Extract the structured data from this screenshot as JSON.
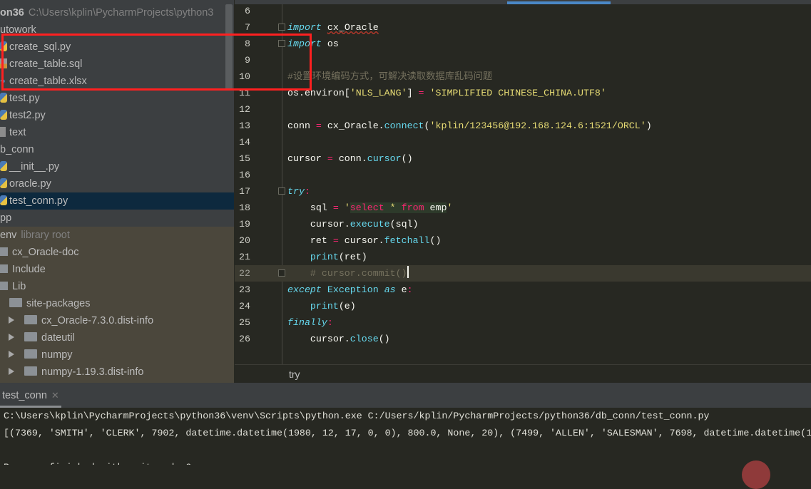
{
  "project_tree": {
    "root": {
      "name": "on36",
      "path": "C:\\Users\\kplin\\PycharmProjects\\python3"
    },
    "items": [
      {
        "label": "utowork",
        "icon": "folder-icon"
      },
      {
        "label": "create_sql.py",
        "icon": "python-file-icon"
      },
      {
        "label": "create_table.sql",
        "icon": "sql-file-icon"
      },
      {
        "label": "create_table.xlsx",
        "icon": "unknown-file-icon"
      },
      {
        "label": "test.py",
        "icon": "python-file-icon"
      },
      {
        "label": "test2.py",
        "icon": "python-file-icon"
      },
      {
        "label": "text",
        "icon": "text-file-icon"
      },
      {
        "label": "b_conn",
        "icon": "folder-icon"
      },
      {
        "label": "__init__.py",
        "icon": "python-file-icon"
      },
      {
        "label": "oracle.py",
        "icon": "python-file-icon"
      },
      {
        "label": "test_conn.py",
        "icon": "python-file-icon",
        "selected": true
      },
      {
        "label": "pp",
        "icon": "folder-icon"
      }
    ],
    "venv": {
      "label": "env",
      "hint": "library root"
    },
    "venv_items": [
      {
        "label": "cx_Oracle-doc",
        "icon": "folder-icon"
      },
      {
        "label": "Include",
        "icon": "folder-icon"
      },
      {
        "label": "Lib",
        "icon": "folder-icon"
      },
      {
        "label": "site-packages",
        "icon": "folder-icon"
      },
      {
        "label": "cx_Oracle-7.3.0.dist-info",
        "icon": "folder-icon",
        "collapsed": true
      },
      {
        "label": "dateutil",
        "icon": "folder-icon",
        "collapsed": true
      },
      {
        "label": "numpy",
        "icon": "folder-icon",
        "collapsed": true
      },
      {
        "label": "numpy-1.19.3.dist-info",
        "icon": "folder-icon",
        "collapsed": true
      }
    ]
  },
  "editor": {
    "current_line": 22,
    "lines": [
      {
        "n": "6",
        "t": []
      },
      {
        "n": "7",
        "fold": true,
        "t": [
          [
            "import",
            "kw"
          ],
          [
            " ",
            "pl"
          ],
          [
            "cx_Oracle",
            "pl wavy"
          ]
        ]
      },
      {
        "n": "8",
        "fold": true,
        "t": [
          [
            "import",
            "kw"
          ],
          [
            " os",
            "pl"
          ]
        ]
      },
      {
        "n": "9",
        "t": []
      },
      {
        "n": "10",
        "t": [
          [
            "#设置环境编码方式，可解决读取数据库乱码问题",
            "cm"
          ]
        ]
      },
      {
        "n": "11",
        "t": [
          [
            "os.environ[",
            "pl"
          ],
          [
            "'NLS_LANG'",
            "st"
          ],
          [
            "] ",
            "pl"
          ],
          [
            "=",
            "op"
          ],
          [
            " ",
            "pl"
          ],
          [
            "'SIMPLIFIED CHINESE_CHINA.UTF8'",
            "st"
          ]
        ]
      },
      {
        "n": "12",
        "t": []
      },
      {
        "n": "13",
        "t": [
          [
            "conn ",
            "pl"
          ],
          [
            "=",
            "op"
          ],
          [
            " cx_Oracle.",
            "pl"
          ],
          [
            "connect",
            "fn"
          ],
          [
            "(",
            "pl"
          ],
          [
            "'kplin/123456@192.168.124.6:1521/ORCL'",
            "st"
          ],
          [
            ")",
            "pl"
          ]
        ]
      },
      {
        "n": "14",
        "t": []
      },
      {
        "n": "15",
        "t": [
          [
            "cursor ",
            "pl"
          ],
          [
            "=",
            "op"
          ],
          [
            " conn.",
            "pl"
          ],
          [
            "cursor",
            "fn"
          ],
          [
            "()",
            "pl"
          ]
        ]
      },
      {
        "n": "16",
        "t": []
      },
      {
        "n": "17",
        "fold": true,
        "t": [
          [
            "try",
            "kw"
          ],
          [
            ":",
            "op"
          ]
        ]
      },
      {
        "n": "18",
        "t": [
          [
            "    sql ",
            "pl"
          ],
          [
            "=",
            "op"
          ],
          [
            " ",
            "pl"
          ],
          [
            "'",
            "st"
          ],
          [
            "select",
            "sq"
          ],
          [
            " ",
            "sqp"
          ],
          [
            "*",
            "sqs"
          ],
          [
            " ",
            "sqp"
          ],
          [
            "from",
            "sq"
          ],
          [
            " emp",
            "sqp"
          ],
          [
            "'",
            "st"
          ]
        ]
      },
      {
        "n": "19",
        "t": [
          [
            "    cursor.",
            "pl"
          ],
          [
            "execute",
            "fn"
          ],
          [
            "(sql)",
            "pl"
          ]
        ]
      },
      {
        "n": "20",
        "t": [
          [
            "    ret ",
            "pl"
          ],
          [
            "=",
            "op"
          ],
          [
            " cursor.",
            "pl"
          ],
          [
            "fetchall",
            "fn"
          ],
          [
            "()",
            "pl"
          ]
        ]
      },
      {
        "n": "21",
        "t": [
          [
            "    ",
            "pl"
          ],
          [
            "print",
            "fn"
          ],
          [
            "(ret)",
            "pl"
          ]
        ]
      },
      {
        "n": "22",
        "fold": true,
        "t": [
          [
            "    # cursor.commit()",
            "cm"
          ]
        ]
      },
      {
        "n": "23",
        "t": [
          [
            "except",
            "kw"
          ],
          [
            " ",
            "pl"
          ],
          [
            "Exception",
            "fn"
          ],
          [
            " ",
            "pl"
          ],
          [
            "as",
            "kw"
          ],
          [
            " e",
            "pl"
          ],
          [
            ":",
            "op"
          ]
        ]
      },
      {
        "n": "24",
        "t": [
          [
            "    ",
            "pl"
          ],
          [
            "print",
            "fn"
          ],
          [
            "(e)",
            "pl"
          ]
        ]
      },
      {
        "n": "25",
        "t": [
          [
            "finally",
            "kw"
          ],
          [
            ":",
            "op"
          ]
        ]
      },
      {
        "n": "26",
        "t": [
          [
            "    cursor.",
            "pl"
          ],
          [
            "close",
            "fn"
          ],
          [
            "()",
            "pl"
          ]
        ]
      }
    ],
    "breadcrumb": "try"
  },
  "run_panel": {
    "tab_label": "test_conn",
    "console_lines": [
      "C:\\Users\\kplin\\PycharmProjects\\python36\\venv\\Scripts\\python.exe C:/Users/kplin/PycharmProjects/python36/db_conn/test_conn.py",
      "[(7369, 'SMITH', 'CLERK', 7902, datetime.datetime(1980, 12, 17, 0, 0), 800.0, None, 20), (7499, 'ALLEN', 'SALESMAN', 7698, datetime.datetime(1",
      "",
      "Process finished with exit code 0"
    ]
  },
  "colors": {
    "accent": "#4a88c7",
    "selection": "#0d293e",
    "highlight_box": "#ff2020"
  }
}
